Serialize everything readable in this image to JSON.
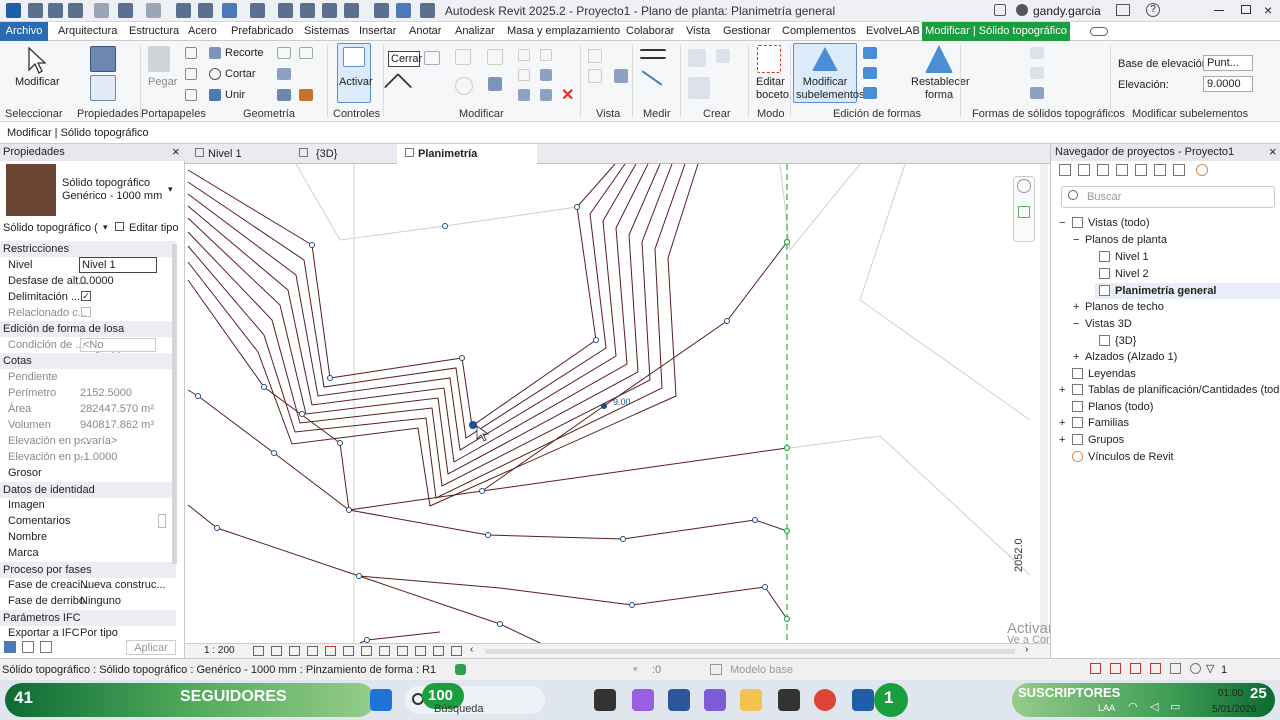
{
  "window": {
    "title": "Autodesk Revit 2025.2 - Proyecto1 - Plano de planta: Planimetría general",
    "user": "gandy.garcia"
  },
  "menu": [
    "Archivo",
    "Arquitectura",
    "Estructura",
    "Acero",
    "Prefabricado",
    "Sistemas",
    "Insertar",
    "Anotar",
    "Analizar",
    "Masa y emplazamiento",
    "Colaborar",
    "Vista",
    "Gestionar",
    "Complementos",
    "EvolveLAB",
    "Modificar | Sólido topográfico"
  ],
  "ribbon": {
    "modificar": "Modificar",
    "pegar": "Pegar",
    "recorte": "Recorte",
    "cortar": "Cortar",
    "unir": "Unir",
    "activar": "Activar",
    "cerrar": "Cerrar",
    "editar_boceto": [
      "Editar",
      "boceto"
    ],
    "modificar_sub": [
      "Modificar",
      "subelementos"
    ],
    "restablecer": [
      "Restablecer",
      "forma"
    ],
    "base_label": "Base de elevación:",
    "base_value": "Punt...",
    "elev_label": "Elevación:",
    "elev_value": "9.0000",
    "groups": [
      "Seleccionar",
      "Propiedades",
      "Portapapeles",
      "Geometría",
      "Controles",
      "Modificar",
      "Vista",
      "Medir",
      "Crear",
      "Modo",
      "Edición de formas",
      "Formas de sólidos topográficos",
      "Modificar subelementos"
    ]
  },
  "context": "Modificar | Sólido topográfico",
  "properties": {
    "header": "Propiedades",
    "type_name": [
      "Sólido topográfico",
      "Genérico - 1000 mm"
    ],
    "selector": "Sólido topográfico (",
    "edit_type": "Editar tipo",
    "sections": {
      "restricciones": "Restricciones",
      "edicion": "Edición de forma de losa",
      "cotas": "Cotas",
      "identidad": "Datos de identidad",
      "fases": "Proceso por fases",
      "ifc": "Parámetros IFC"
    },
    "rows": {
      "nivel": [
        "Nivel",
        "Nivel 1"
      ],
      "desfase": [
        "Desfase de alt...",
        "0.0000"
      ],
      "delim": [
        "Delimitación ..."
      ],
      "relac": [
        "Relacionado c..."
      ],
      "condicion": [
        "Condición de ...",
        "<No aplicable>"
      ],
      "pendiente": [
        "Pendiente"
      ],
      "perimetro": [
        "Perímetro",
        "2152.5000"
      ],
      "area": [
        "Área",
        "282447.570 m²"
      ],
      "volumen": [
        "Volumen",
        "940817.862 m³"
      ],
      "elev1": [
        "Elevación en p...",
        "<varía>"
      ],
      "elev2": [
        "Elevación en p...",
        "-1.0000"
      ],
      "grosor": [
        "Grosor"
      ],
      "imagen": [
        "Imagen"
      ],
      "comentarios": [
        "Comentarios"
      ],
      "nombre": [
        "Nombre"
      ],
      "marca": [
        "Marca"
      ],
      "fase_creac": [
        "Fase de creaci...",
        "Nueva construc..."
      ],
      "fase_derr": [
        "Fase de derribo",
        "Ninguno"
      ],
      "exportar": [
        "Exportar a IFC",
        "Por tipo"
      ]
    },
    "apply": "Aplicar"
  },
  "tabs": [
    "Nivel 1",
    "{3D}",
    "Planimetría general"
  ],
  "canvas": {
    "point_label": "9.00",
    "rotated_label": "2052.0"
  },
  "view_scale": "1 : 200",
  "navigator": {
    "header": "Navegador de proyectos - Proyecto1",
    "search": "Buscar",
    "tree": [
      "Vistas (todo)",
      "Planos de planta",
      "Nivel 1",
      "Nivel 2",
      "Planimetría general",
      "Planos de techo",
      "Vistas 3D",
      "{3D}",
      "Alzados (Alzado 1)",
      "Leyendas",
      "Tablas de planificación/Cantidades (todo)",
      "Planos (todo)",
      "Familias",
      "Grupos",
      "Vínculos de Revit"
    ]
  },
  "status": {
    "text": "Sólido topográfico : Sólido topográfico : Genérico - 1000 mm : Pinzamiento de forma : R1",
    "counter": ":0",
    "model": "Modelo base",
    "filter": "1"
  },
  "watermark": {
    "line1": "Activar Windows",
    "line2": "Ve a Configuración para activar Windows."
  },
  "taskbar": {
    "followers_count": "41",
    "followers": "SEGUIDORES",
    "count100": "100",
    "search": "Búsqueda",
    "badge": "1",
    "subs": "SUSCRIPTORES",
    "subs_count": "25",
    "lang": "LAA",
    "time": "01:00",
    "date": "5/01/2026"
  },
  "colors": {
    "accent": "#2b6cb0",
    "context_tab": "#1b9e3f",
    "contour": "#5a1e1e",
    "point": "#1f4e8c",
    "green_line": "#23b33a"
  }
}
